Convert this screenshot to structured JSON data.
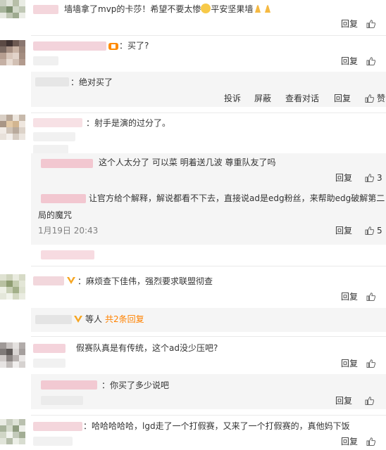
{
  "comments": [
    {
      "text": "墙墙拿了mvp的卡莎！希望不要太惨",
      "text_tail": "平安坚果墙",
      "reply": "回复"
    },
    {
      "text": "：买了?",
      "reply": "回复"
    },
    {
      "sub": "：绝对买了",
      "actions": [
        "投诉",
        "屏蔽",
        "查看对话",
        "回复",
        "赞"
      ]
    },
    {
      "text": "：射手是演的过分了。",
      "reply": "回复"
    },
    {
      "sub": "这个人太分了 可以菜 明着送几波 尊重队友了吗",
      "reply": "回复",
      "like_count": "3"
    },
    {
      "sub_line1": "让官方给个解释，解说都看不下去，直接说ad是edg粉丝，来帮助edg破解第二",
      "sub_line2": "局的魔咒",
      "time": "1月19日 20:43",
      "reply": "回复",
      "like_count": "5"
    },
    {
      "text": "：麻烦查下佳伟，强烈要求联盟彻查",
      "reply": "回复"
    },
    {
      "more_prefix": "等人",
      "more_link": "共2条回复"
    },
    {
      "text": "假赛队真是有传统，这个ad没少压吧?",
      "reply": "回复"
    },
    {
      "sub": "：你买了多少说吧",
      "reply": "回复"
    },
    {
      "text": "：哈哈哈哈哈，lgd走了一个打假赛，又来了一个打假赛的，真他妈下饭",
      "reply": "回复"
    }
  ]
}
